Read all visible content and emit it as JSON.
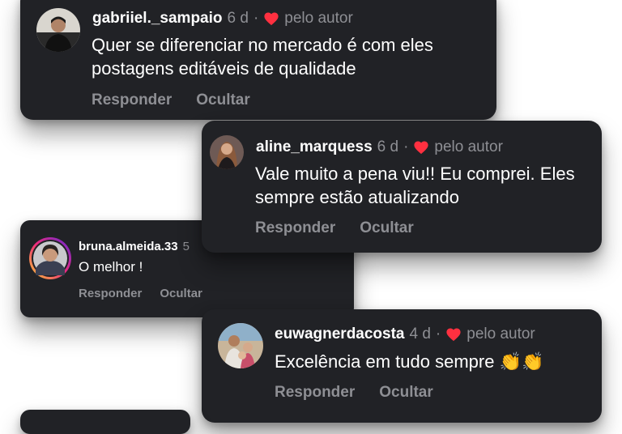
{
  "comments": [
    {
      "username": "gabriiel._sampaio",
      "age": "6 d",
      "separator": "·",
      "author_badge": "pelo autor",
      "text": "Quer se diferenciar no mercado é com eles postagens editáveis de qualidade",
      "reply_label": "Responder",
      "hide_label": "Ocultar"
    },
    {
      "username": "aline_marquess",
      "age": "6 d",
      "separator": "·",
      "author_badge": "pelo autor",
      "text": "Vale muito a pena viu!! Eu comprei. Eles sempre estão atualizando",
      "reply_label": "Responder",
      "hide_label": "Ocultar"
    },
    {
      "username": "bruna.almeida.33",
      "age": "5",
      "text": "O melhor !",
      "reply_label": "Responder",
      "hide_label": "Ocultar"
    },
    {
      "username": "euwagnerdacosta",
      "age": "4 d",
      "separator": "·",
      "author_badge": "pelo autor",
      "text": "Excelência em tudo sempre 👏👏",
      "reply_label": "Responder",
      "hide_label": "Ocultar"
    }
  ],
  "colors": {
    "card_bg": "#212226",
    "muted_text": "#8e8f94",
    "heart": "#ff3040",
    "story_ring_start": "#f9ce34",
    "story_ring_end": "#c13584"
  },
  "icons": [
    "heart-icon"
  ]
}
